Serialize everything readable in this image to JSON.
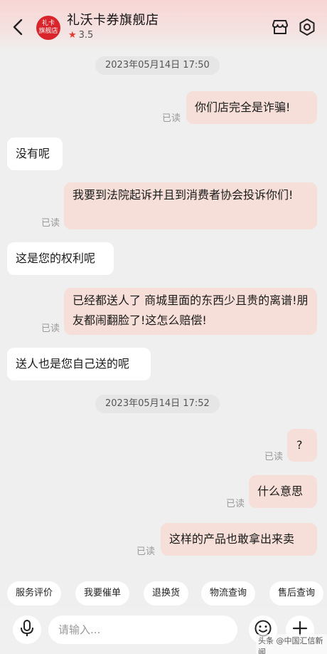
{
  "header": {
    "shop_name": "礼沃卡券旗舰店",
    "rating": "3.5",
    "logo_line1": "礼卡",
    "logo_line2": "旗舰店",
    "icons": {
      "back": "back-icon",
      "store": "store-icon",
      "settings": "settings-icon",
      "rating": "star-icon"
    },
    "colors": {
      "logo": "#d8242a",
      "star": "#e5392f"
    }
  },
  "chat": {
    "timestamps": [
      "2023年05月14日  17:50",
      "2023年05月14日  17:52"
    ],
    "read_label": "已读",
    "messages": [
      {
        "side": "out",
        "text": "你们店完全是诈骗!",
        "read": true
      },
      {
        "side": "in",
        "text": "没有呢"
      },
      {
        "side": "out",
        "text": "我要到法院起诉并且到消费者协会投诉你们!",
        "read": true
      },
      {
        "side": "in",
        "text": "这是您的权利呢"
      },
      {
        "side": "out",
        "text": "已经都送人了  商城里面的东西少且贵的离谱!朋友都闹翻脸了!这怎么赔偿!",
        "read": true
      },
      {
        "side": "in",
        "text": "送人也是您自己送的呢"
      },
      {
        "side": "out",
        "text": "?",
        "read": true
      },
      {
        "side": "out",
        "text": "什么意思",
        "read": true
      },
      {
        "side": "out",
        "text": "这样的产品也敢拿出来卖",
        "read": true
      }
    ],
    "colors": {
      "out_bubble": "#f6dfd8",
      "in_bubble": "#ffffff"
    }
  },
  "quick_actions": [
    "服务评价",
    "我要催单",
    "退换货",
    "物流查询",
    "售后查询"
  ],
  "input": {
    "placeholder": "请输入...",
    "value": "",
    "icons": {
      "voice": "microphone-icon",
      "emoji": "emoji-icon",
      "more": "plus-icon"
    }
  },
  "watermark": "头条 @中国汇信新闻"
}
